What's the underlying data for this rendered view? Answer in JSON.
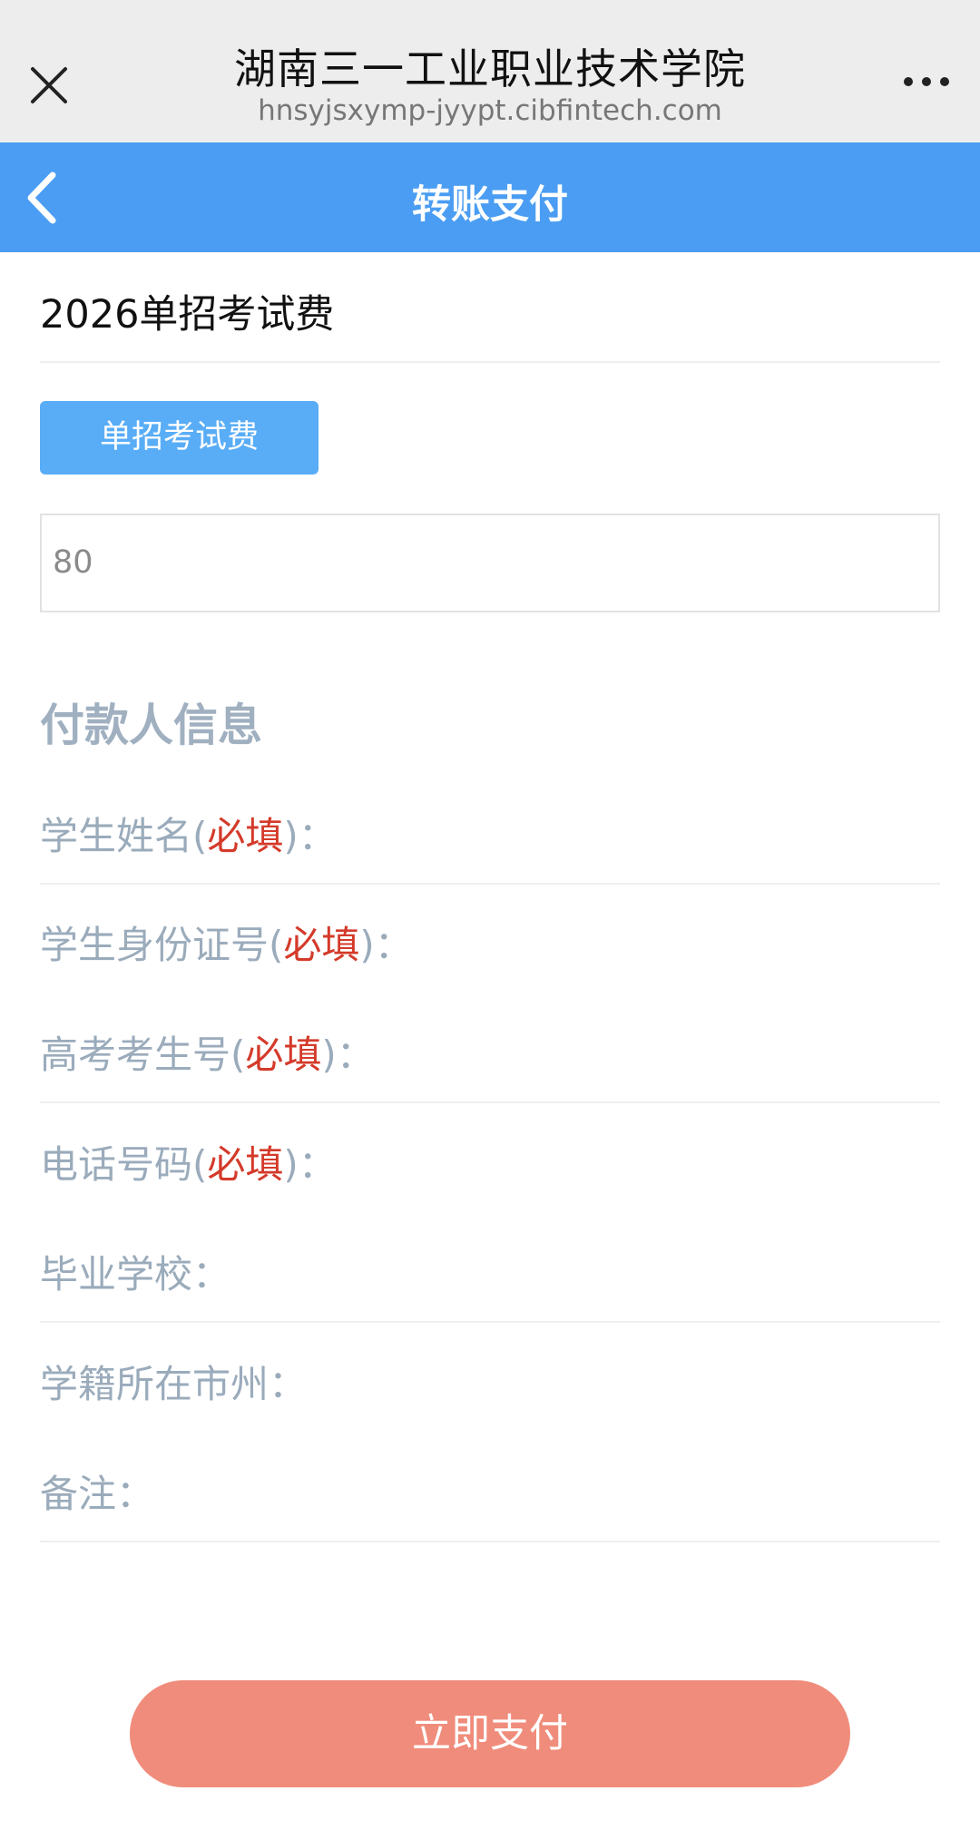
{
  "topbar": {
    "title": "湖南三一工业职业技术学院",
    "url": "hnsyjsxymp-jyypt.cibfintech.com"
  },
  "header": {
    "title": "转账支付"
  },
  "fee": {
    "title": "2026单招考试费",
    "chip_label": "单招考试费",
    "amount": "80"
  },
  "payer": {
    "section_title": "付款人信息",
    "required_text": "必填",
    "fields": [
      {
        "label": "学生姓名",
        "required": true
      },
      {
        "label": "学生身份证号",
        "required": true
      },
      {
        "label": "高考考生号",
        "required": true
      },
      {
        "label": "电话号码",
        "required": true
      },
      {
        "label": "毕业学校",
        "required": false
      },
      {
        "label": "学籍所在市州",
        "required": false
      },
      {
        "label": "备注",
        "required": false
      }
    ]
  },
  "pay_button": {
    "label": "立即支付"
  },
  "colors": {
    "header_blue": "#4a9df2",
    "chip_blue": "#59adf6",
    "required_red": "#d43a2a",
    "pay_button": "#f08c7b"
  }
}
